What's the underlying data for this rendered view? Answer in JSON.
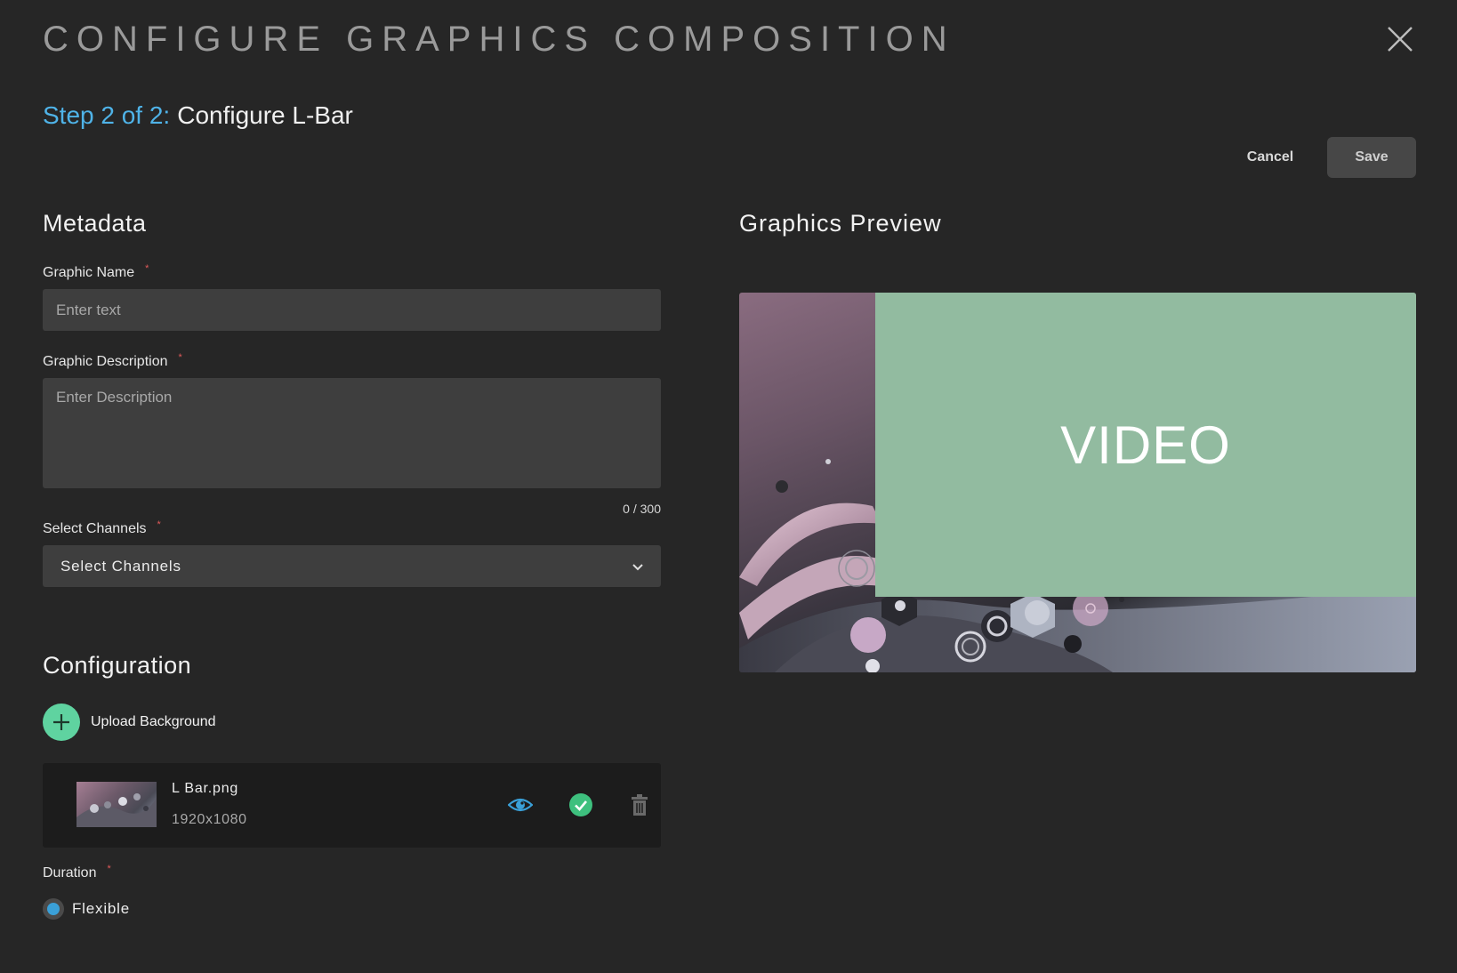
{
  "header": {
    "title": "CONFIGURE GRAPHICS COMPOSITION",
    "close_icon": "close-icon"
  },
  "step": {
    "prefix": "Step 2 of 2:",
    "title": "Configure L-Bar"
  },
  "actions": {
    "cancel_label": "Cancel",
    "save_label": "Save"
  },
  "metadata": {
    "heading": "Metadata",
    "graphic_name": {
      "label": "Graphic Name",
      "required_mark": "*",
      "value": "",
      "placeholder": "Enter text"
    },
    "graphic_description": {
      "label": "Graphic Description",
      "required_mark": "*",
      "value": "",
      "placeholder": "Enter Description",
      "counter": "0 / 300"
    },
    "channels": {
      "label": "Select Channels",
      "required_mark": "*",
      "selected": "Select Channels"
    }
  },
  "configuration": {
    "heading": "Configuration",
    "upload_label": "Upload Background",
    "file": {
      "name": "L Bar.png",
      "dimensions": "1920x1080"
    },
    "duration": {
      "label": "Duration",
      "required_mark": "*",
      "option": "Flexible",
      "selected": true
    }
  },
  "preview": {
    "heading": "Graphics Preview",
    "video_label": "VIDEO"
  },
  "colors": {
    "accent_blue": "#4fb3e8",
    "accent_green": "#5fd3a0",
    "video_green": "#92bba0",
    "background": "#262626"
  }
}
